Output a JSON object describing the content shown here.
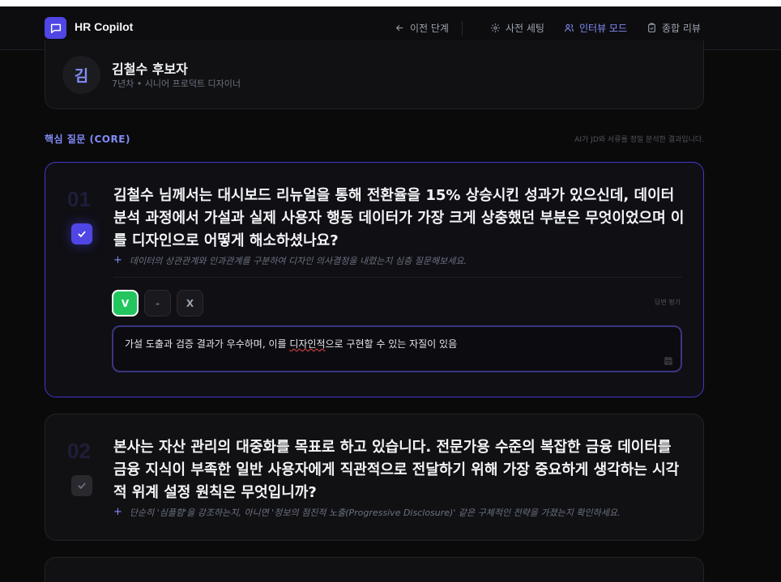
{
  "app": {
    "title": "HR Copilot"
  },
  "nav": {
    "back": "이전 단계",
    "pre_setting": "사전 세팅",
    "interview_mode": "인터뷰 모드",
    "review": "종합 리뷰"
  },
  "candidate": {
    "avatar": "김",
    "name": "김철수 후보자",
    "sub": "7년차 • 시니어 프로덕트 디자이너"
  },
  "section": {
    "title": "핵심 질문 (CORE)",
    "note": "AI가 JD와 서류를 정밀 분석한 결과입니다."
  },
  "questions": [
    {
      "num": "01",
      "text": "김철수 님께서는 대시보드 리뉴얼을 통해 전환율을 15% 상승시킨 성과가 있으신데, 데이터 분석 과정에서 가설과 실제 사용자 행동 데이터가 가장 크게 상충했던 부분은 무엇이었으며 이를 디자인으로 어떻게 해소하셨나요?",
      "hint": "데이터의 상관관계와 인과관계를 구분하여 디자인 의사결정을 내렸는지 심층 질문해보세요.",
      "checked": true,
      "eval": {
        "v": "V",
        "dash": "-",
        "x": "X",
        "label": "답변 평가",
        "selected": "V"
      },
      "answer_pre": "가설 도출과 검증 결과가 우수하며, 이를 ",
      "answer_spell": "디자인적",
      "answer_post": "으로 구현할 수 있는 자질이 있음"
    },
    {
      "num": "02",
      "text": "본사는 자산 관리의 대중화를 목표로 하고 있습니다. 전문가용 수준의 복잡한 금융 데이터를 금융 지식이 부족한 일반 사용자에게 직관적으로 전달하기 위해 가장 중요하게 생각하는 시각적 위계 설정 원칙은 무엇입니까?",
      "hint": "단순히 '심플함'을 강조하는지, 아니면 '정보의 점진적 노출(Progressive Disclosure)' 같은 구체적인 전략을 가졌는지 확인하세요.",
      "checked": false
    }
  ],
  "colors": {
    "accent": "#4f46e5",
    "accent_text": "#818cf8",
    "success": "#22c55e",
    "background": "#0a0a0b"
  },
  "icons": [
    "chat-bubble-icon",
    "arrow-left-icon",
    "gear-icon",
    "users-icon",
    "clipboard-icon",
    "check-icon",
    "plus-icon",
    "save-icon"
  ]
}
